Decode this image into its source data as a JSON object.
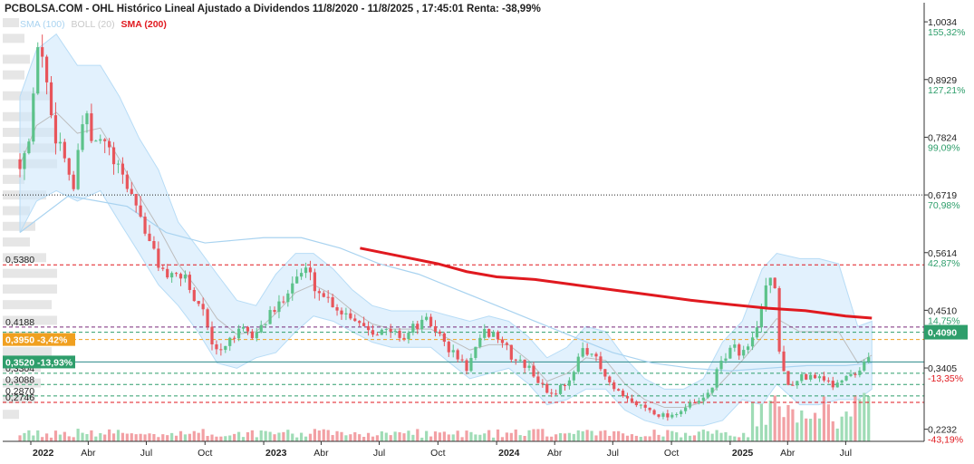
{
  "header": {
    "title": "PCBOLSA.COM - OHL Histórico Lineal Ajustado a Dividendos 11/8/2020 - 11/8/2025 , 17:45:01 Renta: -38,99%"
  },
  "legend": {
    "items": [
      {
        "label": "SMA (100)",
        "color": "#a9d3f0"
      },
      {
        "label": "BOLL (20)",
        "color": "#c8c8c8"
      },
      {
        "label": "SMA (200)",
        "color": "#e0191f"
      }
    ]
  },
  "chart_data": {
    "type": "candlestick",
    "x_ticks": [
      {
        "label": "2022",
        "date": "2022-01-01",
        "bold": true
      },
      {
        "label": "Abr",
        "date": "2022-04-01"
      },
      {
        "label": "Jul",
        "date": "2022-07-01"
      },
      {
        "label": "Oct",
        "date": "2022-10-01"
      },
      {
        "label": "2023",
        "date": "2023-01-01",
        "bold": true
      },
      {
        "label": "Abr",
        "date": "2023-04-01"
      },
      {
        "label": "Jul",
        "date": "2023-07-01"
      },
      {
        "label": "Oct",
        "date": "2023-10-01"
      },
      {
        "label": "2024",
        "date": "2024-01-01",
        "bold": true
      },
      {
        "label": "Abr",
        "date": "2024-04-01"
      },
      {
        "label": "Jul",
        "date": "2024-07-01"
      },
      {
        "label": "Oct",
        "date": "2024-10-01"
      },
      {
        "label": "2025",
        "date": "2025-01-01",
        "bold": true
      },
      {
        "label": "Abr",
        "date": "2025-04-01"
      },
      {
        "label": "Jul",
        "date": "2025-07-01"
      }
    ],
    "y_range": [
      0.2,
      1.04
    ],
    "right_axis": [
      {
        "value": 1.0034,
        "label": "1,0034",
        "pct": "155,32%",
        "pct_color": "#2e9e6b"
      },
      {
        "value": 0.8929,
        "label": "0,8929",
        "pct": "127,21%",
        "pct_color": "#2e9e6b"
      },
      {
        "value": 0.7824,
        "label": "0,7824",
        "pct": "99,09%",
        "pct_color": "#2e9e6b"
      },
      {
        "value": 0.6719,
        "label": "0,6719",
        "pct": "70,98%",
        "pct_color": "#2e9e6b"
      },
      {
        "value": 0.5614,
        "label": "0,5614",
        "pct": "42,87%",
        "pct_color": "#2e9e6b"
      },
      {
        "value": 0.451,
        "label": "0,4510",
        "pct": "14,75%",
        "pct_color": "#2e9e6b"
      },
      {
        "value": 0.3405,
        "label": "0,3405",
        "pct": "-13,35%",
        "pct_color": "#e0191f"
      },
      {
        "value": 0.2232,
        "label": "0,2232",
        "pct": "-43,19%",
        "pct_color": "#e0191f"
      }
    ],
    "left_levels": [
      {
        "value": 0.538,
        "label": "0,5380"
      },
      {
        "value": 0.4188,
        "label": "0,4188"
      },
      {
        "value": 0.3304,
        "label": "0,3304"
      },
      {
        "value": 0.3088,
        "label": "0,3088"
      },
      {
        "value": 0.287,
        "label": "0,2870"
      },
      {
        "value": 0.2746,
        "label": "0,2746"
      }
    ],
    "level_lines": [
      {
        "value": 0.6719,
        "color": "#222222",
        "style": "dotted"
      },
      {
        "value": 0.538,
        "color": "#e0191f",
        "style": "dashed"
      },
      {
        "value": 0.4188,
        "color": "#7a2a7a",
        "style": "dashed"
      },
      {
        "value": 0.409,
        "color": "#2e9e6b",
        "style": "dashed"
      },
      {
        "value": 0.395,
        "color": "#f0a020",
        "style": "dashed"
      },
      {
        "value": 0.352,
        "color": "#2a8a8a",
        "style": "solid"
      },
      {
        "value": 0.3304,
        "color": "#2e9e6b",
        "style": "dashed"
      },
      {
        "value": 0.3088,
        "color": "#2e9e6b",
        "style": "dashed"
      },
      {
        "value": 0.287,
        "color": "#2e9e6b",
        "style": "dashed"
      },
      {
        "value": 0.2746,
        "color": "#e0191f",
        "style": "dashed"
      }
    ],
    "badges": [
      {
        "value": 0.395,
        "text": "0,3950 -3,42%",
        "color": "#f0a020"
      },
      {
        "value": 0.352,
        "text": "0,3520 -13,93%",
        "color": "#2e9e6b"
      }
    ],
    "last_price": {
      "value": 0.409,
      "label": "0,4090",
      "color": "#2e9e6b"
    },
    "close_anchors": [
      [
        "2021-12-15",
        0.74
      ],
      [
        "2022-01-01",
        0.78
      ],
      [
        "2022-01-12",
        0.97
      ],
      [
        "2022-01-22",
        0.92
      ],
      [
        "2022-02-05",
        0.8
      ],
      [
        "2022-02-20",
        0.76
      ],
      [
        "2022-03-10",
        0.68
      ],
      [
        "2022-03-25",
        0.83
      ],
      [
        "2022-04-10",
        0.76
      ],
      [
        "2022-04-25",
        0.78
      ],
      [
        "2022-05-15",
        0.72
      ],
      [
        "2022-06-01",
        0.69
      ],
      [
        "2022-06-20",
        0.64
      ],
      [
        "2022-07-05",
        0.58
      ],
      [
        "2022-07-25",
        0.53
      ],
      [
        "2022-08-10",
        0.51
      ],
      [
        "2022-08-30",
        0.52
      ],
      [
        "2022-09-15",
        0.47
      ],
      [
        "2022-09-28",
        0.46
      ],
      [
        "2022-10-10",
        0.38
      ],
      [
        "2022-10-25",
        0.37
      ],
      [
        "2022-11-10",
        0.4
      ],
      [
        "2022-11-30",
        0.41
      ],
      [
        "2022-12-15",
        0.4
      ],
      [
        "2023-01-10",
        0.44
      ],
      [
        "2023-01-25",
        0.46
      ],
      [
        "2023-02-10",
        0.5
      ],
      [
        "2023-02-25",
        0.52
      ],
      [
        "2023-03-10",
        0.53
      ],
      [
        "2023-03-25",
        0.49
      ],
      [
        "2023-04-15",
        0.47
      ],
      [
        "2023-05-01",
        0.45
      ],
      [
        "2023-05-20",
        0.44
      ],
      [
        "2023-06-10",
        0.42
      ],
      [
        "2023-06-30",
        0.41
      ],
      [
        "2023-07-20",
        0.41
      ],
      [
        "2023-08-10",
        0.4
      ],
      [
        "2023-08-25",
        0.42
      ],
      [
        "2023-09-15",
        0.43
      ],
      [
        "2023-09-30",
        0.41
      ],
      [
        "2023-10-15",
        0.38
      ],
      [
        "2023-11-01",
        0.36
      ],
      [
        "2023-11-15",
        0.34
      ],
      [
        "2023-12-01",
        0.38
      ],
      [
        "2023-12-15",
        0.41
      ],
      [
        "2024-01-05",
        0.4
      ],
      [
        "2024-01-25",
        0.36
      ],
      [
        "2024-02-10",
        0.35
      ],
      [
        "2024-02-28",
        0.33
      ],
      [
        "2024-03-15",
        0.3
      ],
      [
        "2024-03-30",
        0.29
      ],
      [
        "2024-04-15",
        0.31
      ],
      [
        "2024-05-01",
        0.33
      ],
      [
        "2024-05-15",
        0.38
      ],
      [
        "2024-05-30",
        0.37
      ],
      [
        "2024-06-15",
        0.33
      ],
      [
        "2024-07-01",
        0.3
      ],
      [
        "2024-07-20",
        0.28
      ],
      [
        "2024-08-10",
        0.27
      ],
      [
        "2024-08-30",
        0.26
      ],
      [
        "2024-09-15",
        0.25
      ],
      [
        "2024-09-30",
        0.25
      ],
      [
        "2024-10-15",
        0.26
      ],
      [
        "2024-11-01",
        0.27
      ],
      [
        "2024-11-20",
        0.28
      ],
      [
        "2024-12-05",
        0.31
      ],
      [
        "2024-12-20",
        0.36
      ],
      [
        "2025-01-05",
        0.38
      ],
      [
        "2025-01-20",
        0.37
      ],
      [
        "2025-02-01",
        0.38
      ],
      [
        "2025-02-10",
        0.41
      ],
      [
        "2025-02-20",
        0.47
      ],
      [
        "2025-03-01",
        0.52
      ],
      [
        "2025-03-08",
        0.53
      ],
      [
        "2025-03-15",
        0.45
      ],
      [
        "2025-03-20",
        0.35
      ],
      [
        "2025-04-01",
        0.31
      ],
      [
        "2025-04-20",
        0.32
      ],
      [
        "2025-05-10",
        0.33
      ],
      [
        "2025-05-25",
        0.32
      ],
      [
        "2025-06-10",
        0.31
      ],
      [
        "2025-06-25",
        0.32
      ],
      [
        "2025-07-10",
        0.33
      ],
      [
        "2025-07-25",
        0.34
      ],
      [
        "2025-08-05",
        0.36
      ],
      [
        "2025-08-11",
        0.409
      ]
    ],
    "sma200": [
      [
        "2023-06-01",
        0.57
      ],
      [
        "2023-08-01",
        0.555
      ],
      [
        "2023-10-01",
        0.54
      ],
      [
        "2023-11-15",
        0.525
      ],
      [
        "2024-01-01",
        0.515
      ],
      [
        "2024-03-01",
        0.51
      ],
      [
        "2024-05-01",
        0.5
      ],
      [
        "2024-07-01",
        0.49
      ],
      [
        "2024-09-01",
        0.48
      ],
      [
        "2024-11-01",
        0.47
      ],
      [
        "2025-01-01",
        0.462
      ],
      [
        "2025-03-01",
        0.455
      ],
      [
        "2025-05-01",
        0.45
      ],
      [
        "2025-07-01",
        0.44
      ],
      [
        "2025-08-11",
        0.436
      ]
    ],
    "sma100": [
      [
        "2021-12-15",
        0.6
      ],
      [
        "2022-03-01",
        0.67
      ],
      [
        "2022-06-01",
        0.65
      ],
      [
        "2022-08-01",
        0.6
      ],
      [
        "2022-10-01",
        0.58
      ],
      [
        "2023-01-01",
        0.59
      ],
      [
        "2023-03-01",
        0.59
      ],
      [
        "2023-05-01",
        0.57
      ],
      [
        "2023-07-01",
        0.54
      ],
      [
        "2023-09-01",
        0.52
      ],
      [
        "2023-11-01",
        0.49
      ],
      [
        "2024-01-01",
        0.46
      ],
      [
        "2024-03-01",
        0.43
      ],
      [
        "2024-05-01",
        0.4
      ],
      [
        "2024-07-01",
        0.37
      ],
      [
        "2024-09-01",
        0.35
      ],
      [
        "2024-11-01",
        0.34
      ],
      [
        "2025-01-01",
        0.335
      ],
      [
        "2025-03-01",
        0.34
      ],
      [
        "2025-05-01",
        0.345
      ],
      [
        "2025-07-01",
        0.345
      ],
      [
        "2025-08-11",
        0.35
      ]
    ],
    "boll_upper": [
      [
        "2021-12-15",
        0.86
      ],
      [
        "2022-01-10",
        0.95
      ],
      [
        "2022-02-10",
        0.98
      ],
      [
        "2022-03-15",
        0.92
      ],
      [
        "2022-04-20",
        0.92
      ],
      [
        "2022-05-20",
        0.86
      ],
      [
        "2022-06-20",
        0.78
      ],
      [
        "2022-07-20",
        0.72
      ],
      [
        "2022-08-20",
        0.62
      ],
      [
        "2022-09-20",
        0.57
      ],
      [
        "2022-10-20",
        0.52
      ],
      [
        "2022-11-20",
        0.47
      ],
      [
        "2022-12-20",
        0.46
      ],
      [
        "2023-01-20",
        0.52
      ],
      [
        "2023-02-20",
        0.56
      ],
      [
        "2023-03-20",
        0.56
      ],
      [
        "2023-04-20",
        0.53
      ],
      [
        "2023-05-20",
        0.49
      ],
      [
        "2023-06-20",
        0.46
      ],
      [
        "2023-07-20",
        0.45
      ],
      [
        "2023-08-20",
        0.45
      ],
      [
        "2023-09-20",
        0.45
      ],
      [
        "2023-10-20",
        0.44
      ],
      [
        "2023-11-20",
        0.43
      ],
      [
        "2023-12-20",
        0.44
      ],
      [
        "2024-01-20",
        0.43
      ],
      [
        "2024-02-20",
        0.4
      ],
      [
        "2024-03-20",
        0.36
      ],
      [
        "2024-04-20",
        0.38
      ],
      [
        "2024-05-20",
        0.42
      ],
      [
        "2024-06-20",
        0.41
      ],
      [
        "2024-07-20",
        0.36
      ],
      [
        "2024-08-20",
        0.32
      ],
      [
        "2024-09-20",
        0.3
      ],
      [
        "2024-10-20",
        0.3
      ],
      [
        "2024-11-20",
        0.32
      ],
      [
        "2024-12-20",
        0.39
      ],
      [
        "2025-01-20",
        0.43
      ],
      [
        "2025-02-20",
        0.53
      ],
      [
        "2025-03-15",
        0.56
      ],
      [
        "2025-04-20",
        0.55
      ],
      [
        "2025-05-20",
        0.55
      ],
      [
        "2025-06-20",
        0.54
      ],
      [
        "2025-07-20",
        0.42
      ],
      [
        "2025-08-11",
        0.43
      ]
    ],
    "boll_lower": [
      [
        "2021-12-15",
        0.6
      ],
      [
        "2022-01-10",
        0.66
      ],
      [
        "2022-02-10",
        0.68
      ],
      [
        "2022-03-15",
        0.66
      ],
      [
        "2022-04-20",
        0.68
      ],
      [
        "2022-05-20",
        0.62
      ],
      [
        "2022-06-20",
        0.56
      ],
      [
        "2022-07-20",
        0.5
      ],
      [
        "2022-08-20",
        0.46
      ],
      [
        "2022-09-20",
        0.41
      ],
      [
        "2022-10-20",
        0.35
      ],
      [
        "2022-11-20",
        0.34
      ],
      [
        "2022-12-20",
        0.36
      ],
      [
        "2023-01-20",
        0.37
      ],
      [
        "2023-02-20",
        0.41
      ],
      [
        "2023-03-20",
        0.44
      ],
      [
        "2023-04-20",
        0.43
      ],
      [
        "2023-05-20",
        0.41
      ],
      [
        "2023-06-20",
        0.39
      ],
      [
        "2023-07-20",
        0.38
      ],
      [
        "2023-08-20",
        0.38
      ],
      [
        "2023-09-20",
        0.38
      ],
      [
        "2023-10-20",
        0.35
      ],
      [
        "2023-11-20",
        0.32
      ],
      [
        "2023-12-20",
        0.33
      ],
      [
        "2024-01-20",
        0.34
      ],
      [
        "2024-02-20",
        0.31
      ],
      [
        "2024-03-20",
        0.27
      ],
      [
        "2024-04-20",
        0.28
      ],
      [
        "2024-05-20",
        0.3
      ],
      [
        "2024-06-20",
        0.3
      ],
      [
        "2024-07-20",
        0.26
      ],
      [
        "2024-08-20",
        0.24
      ],
      [
        "2024-09-20",
        0.23
      ],
      [
        "2024-10-20",
        0.23
      ],
      [
        "2024-11-20",
        0.23
      ],
      [
        "2024-12-20",
        0.24
      ],
      [
        "2025-01-20",
        0.28
      ],
      [
        "2025-02-20",
        0.27
      ],
      [
        "2025-03-15",
        0.31
      ],
      [
        "2025-04-20",
        0.27
      ],
      [
        "2025-05-20",
        0.27
      ],
      [
        "2025-06-20",
        0.28
      ],
      [
        "2025-07-20",
        0.28
      ],
      [
        "2025-08-11",
        0.3
      ]
    ],
    "volume_profile": [
      [
        1.0,
        0.3
      ],
      [
        0.97,
        0.4
      ],
      [
        0.93,
        0.5
      ],
      [
        0.9,
        0.4
      ],
      [
        0.86,
        0.9
      ],
      [
        0.82,
        0.6
      ],
      [
        0.79,
        1.0
      ],
      [
        0.76,
        1.0
      ],
      [
        0.73,
        1.0
      ],
      [
        0.7,
        0.4
      ],
      [
        0.67,
        0.8
      ],
      [
        0.64,
        0.5
      ],
      [
        0.61,
        0.6
      ],
      [
        0.58,
        0.5
      ],
      [
        0.55,
        0.8
      ],
      [
        0.52,
        1.0
      ],
      [
        0.49,
        1.0
      ],
      [
        0.46,
        0.9
      ],
      [
        0.43,
        1.0
      ],
      [
        0.4,
        0.9
      ],
      [
        0.37,
        0.9
      ],
      [
        0.34,
        0.7
      ],
      [
        0.31,
        0.7
      ],
      [
        0.28,
        0.6
      ],
      [
        0.25,
        0.3
      ]
    ]
  }
}
